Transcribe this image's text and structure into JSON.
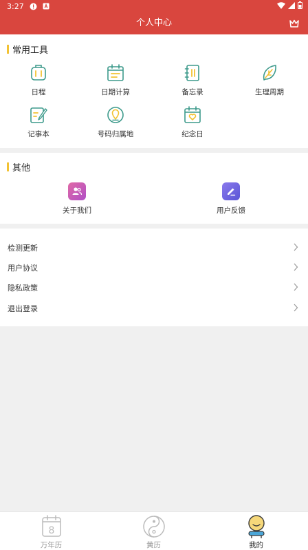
{
  "status": {
    "time": "3:27"
  },
  "header": {
    "title": "个人中心"
  },
  "tools": {
    "title": "常用工具",
    "items": [
      "日程",
      "日期计算",
      "备忘录",
      "生理周期",
      "记事本",
      "号码归属地",
      "纪念日"
    ]
  },
  "other": {
    "title": "其他",
    "items": [
      "关于我们",
      "用户反馈"
    ]
  },
  "menu": {
    "items": [
      "检测更新",
      "用户协议",
      "隐私政策",
      "退出登录"
    ]
  },
  "tabbar": {
    "items": [
      "万年历",
      "黄历",
      "我的"
    ],
    "calendar_day": "8",
    "active_index": 2
  },
  "colors": {
    "brand": "#d9463e",
    "icon_teal": "#3d9a8b",
    "accent_yellow": "#f2c233",
    "about_gradient": "#c64fc0",
    "feedback_gradient": "#6a5fe0",
    "tab_inactive": "#999999",
    "tab_active": "#333333"
  }
}
